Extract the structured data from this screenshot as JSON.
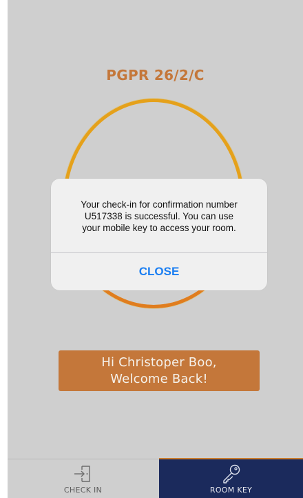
{
  "room": {
    "number": "PGPR 26/2/C"
  },
  "welcome": {
    "line1": "Hi Christoper Boo,",
    "line2": "Welcome Back!"
  },
  "alert": {
    "line1": "Your check-in for confirmation number",
    "line2": "U517338 is successful. You can use",
    "line3": "your mobile key to access your room.",
    "close_label": "CLOSE"
  },
  "tabs": [
    {
      "label": "CHECK IN",
      "icon": "door-enter-icon",
      "selected": false
    },
    {
      "label": "ROOM KEY",
      "icon": "key-icon",
      "selected": true
    }
  ],
  "colors": {
    "background": "#cfcfcf",
    "accent_orange": "#c4773a",
    "ring_gold": "#e5a11b",
    "tab_selected": "#1b2a5c",
    "alert_button": "#1a7ef2"
  }
}
